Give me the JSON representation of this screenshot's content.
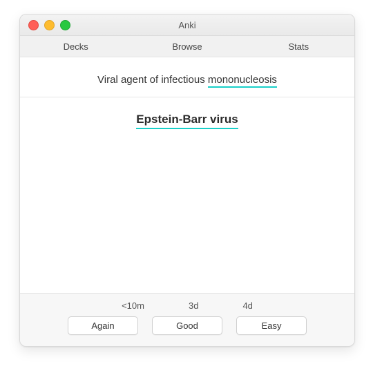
{
  "window": {
    "title": "Anki"
  },
  "tabs": {
    "decks": "Decks",
    "browse": "Browse",
    "stats": "Stats"
  },
  "card": {
    "front_prefix": "Viral agent of infectious ",
    "front_underlined": "mononucleosis",
    "answer": "Epstein-Barr virus"
  },
  "review": {
    "times": {
      "again": "<10m",
      "good": "3d",
      "easy": "4d"
    },
    "buttons": {
      "again": "Again",
      "good": "Good",
      "easy": "Easy"
    }
  },
  "colors": {
    "underline": "#18d0c9"
  }
}
